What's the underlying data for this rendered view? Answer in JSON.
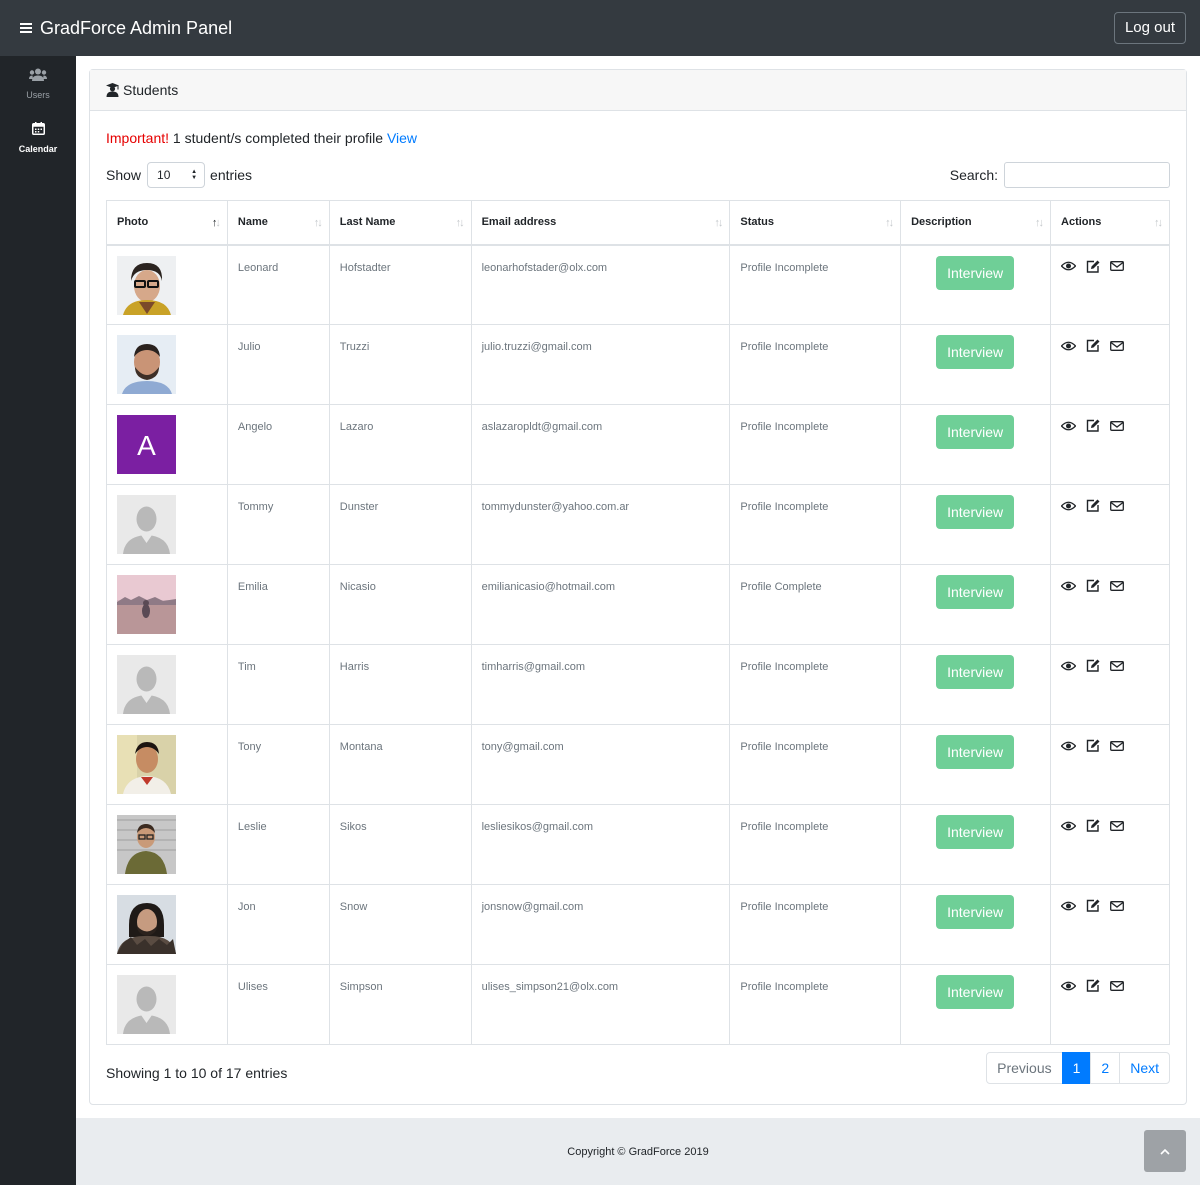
{
  "header": {
    "title": "GradForce Admin Panel",
    "logout_label": "Log out",
    "menu_icon": "hamburger-icon"
  },
  "sidebar": {
    "items": [
      {
        "label": "Users",
        "icon": "users-icon"
      },
      {
        "label": "Calendar",
        "icon": "calendar-icon"
      }
    ]
  },
  "card": {
    "title": "Students",
    "icon": "graduate-icon"
  },
  "notice": {
    "important": "Important!",
    "text": " 1 student/s completed their profile ",
    "link": "View"
  },
  "length": {
    "show_label": "Show",
    "value": "10",
    "entries_label": "entries"
  },
  "search": {
    "label": "Search:",
    "value": ""
  },
  "table": {
    "columns": [
      "Photo",
      "Name",
      "Last Name",
      "Email address",
      "Status",
      "Description",
      "Actions"
    ],
    "rows": [
      {
        "avatar": "leonard",
        "name": "Leonard",
        "last_name": "Hofstadter",
        "email": "leonarhofstader@olx.com",
        "status": "Profile Incomplete",
        "action": "Interview"
      },
      {
        "avatar": "julio",
        "name": "Julio",
        "last_name": "Truzzi",
        "email": "julio.truzzi@gmail.com",
        "status": "Profile Incomplete",
        "action": "Interview"
      },
      {
        "avatar": "letter",
        "avatar_letter": "A",
        "name": "Angelo",
        "last_name": "Lazaro",
        "email": "aslazaropldt@gmail.com",
        "status": "Profile Incomplete",
        "action": "Interview"
      },
      {
        "avatar": "default",
        "name": "Tommy",
        "last_name": "Dunster",
        "email": "tommydunster@yahoo.com.ar",
        "status": "Profile Incomplete",
        "action": "Interview"
      },
      {
        "avatar": "landscape",
        "name": "Emilia",
        "last_name": "Nicasio",
        "email": "emilianicasio@hotmail.com",
        "status": "Profile Complete",
        "action": "Interview"
      },
      {
        "avatar": "default",
        "name": "Tim",
        "last_name": "Harris",
        "email": "timharris@gmail.com",
        "status": "Profile Incomplete",
        "action": "Interview"
      },
      {
        "avatar": "tony",
        "name": "Tony",
        "last_name": "Montana",
        "email": "tony@gmail.com",
        "status": "Profile Incomplete",
        "action": "Interview"
      },
      {
        "avatar": "leslie",
        "name": "Leslie",
        "last_name": "Sikos",
        "email": "lesliesikos@gmail.com",
        "status": "Profile Incomplete",
        "action": "Interview"
      },
      {
        "avatar": "jon",
        "name": "Jon",
        "last_name": "Snow",
        "email": "jonsnow@gmail.com",
        "status": "Profile Incomplete",
        "action": "Interview"
      },
      {
        "avatar": "default",
        "name": "Ulises",
        "last_name": "Simpson",
        "email": "ulises_simpson21@olx.com",
        "status": "Profile Incomplete",
        "action": "Interview"
      }
    ]
  },
  "info": "Showing 1 to 10 of 17 entries",
  "pagination": {
    "previous": "Previous",
    "pages": [
      "1",
      "2"
    ],
    "active": "1",
    "next": "Next"
  },
  "footer": {
    "copyright": "Copyright © GradForce 2019"
  },
  "colors": {
    "topbar": "#343a40",
    "sidebar": "#212529",
    "interview_button": "#6fcf97",
    "primary": "#007bff",
    "important": "#e60000"
  }
}
